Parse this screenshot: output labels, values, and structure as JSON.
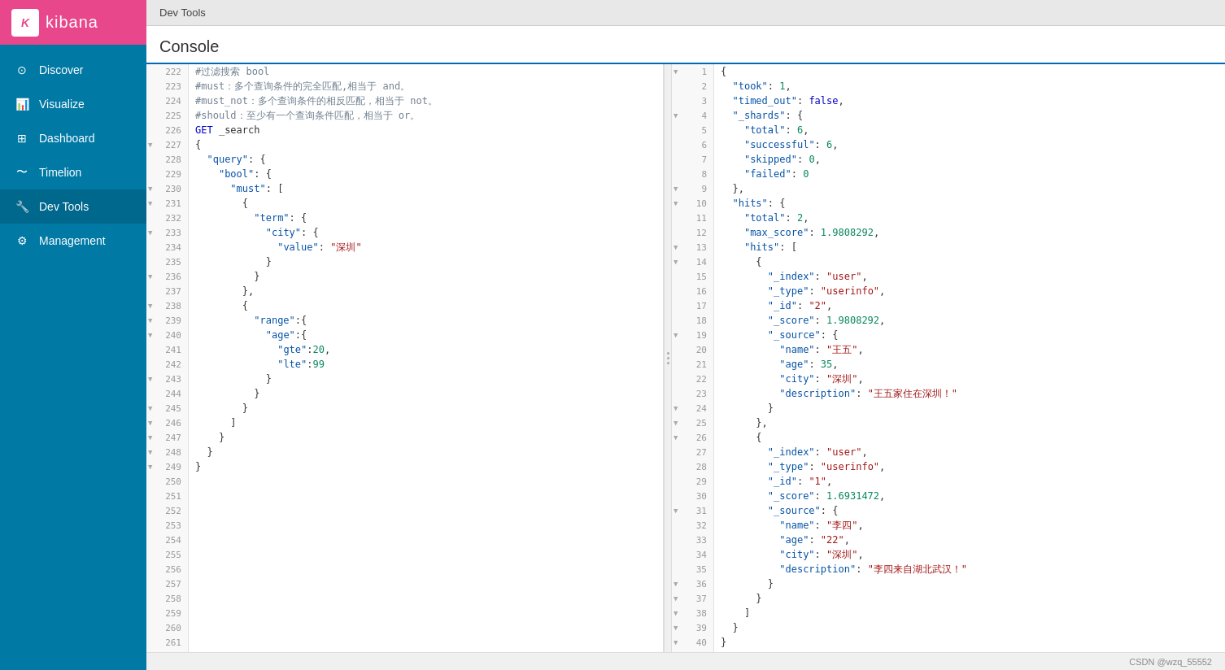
{
  "app": {
    "title": "kibana",
    "top_bar": "Dev Tools",
    "console_title": "Console"
  },
  "sidebar": {
    "items": [
      {
        "label": "Discover",
        "icon": "compass"
      },
      {
        "label": "Visualize",
        "icon": "bar-chart"
      },
      {
        "label": "Dashboard",
        "icon": "grid"
      },
      {
        "label": "Timelion",
        "icon": "timelion"
      },
      {
        "label": "Dev Tools",
        "icon": "wrench",
        "active": true
      },
      {
        "label": "Management",
        "icon": "gear"
      }
    ]
  },
  "footer": {
    "text": "CSDN @wzq_55552"
  }
}
